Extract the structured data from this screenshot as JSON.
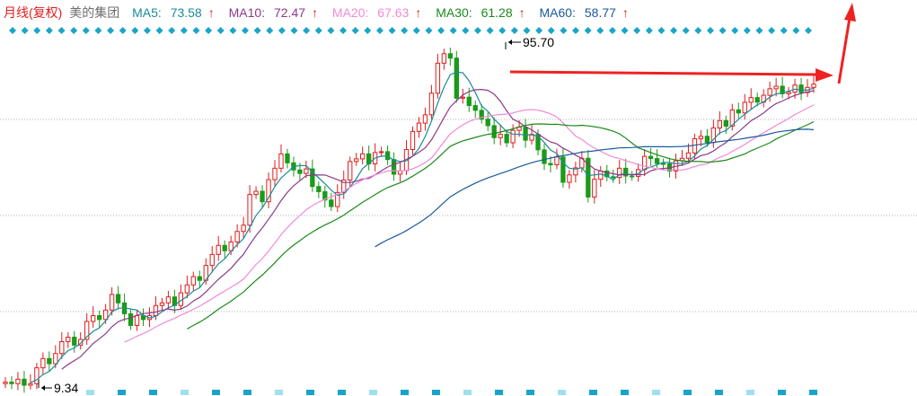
{
  "header": {
    "title": "月线(复权)",
    "stock_name": "美的集团"
  },
  "indicators": [
    {
      "label": "MA5:",
      "value": "73.58",
      "trend": "↑",
      "color": "#1a8a9a"
    },
    {
      "label": "MA10:",
      "value": "72.47",
      "trend": "↑",
      "color": "#8a3a8a"
    },
    {
      "label": "MA20:",
      "value": "67.63",
      "trend": "↑",
      "color": "#f08ad8"
    },
    {
      "label": "MA30:",
      "value": "61.28",
      "trend": "↑",
      "color": "#1a8a1a"
    },
    {
      "label": "MA60:",
      "value": "58.77",
      "trend": "↑",
      "color": "#1a5a9a"
    }
  ],
  "annotations": {
    "high_label": "95.70",
    "low_label": "9.34"
  },
  "colors": {
    "up": "#e01c1c",
    "down": "#1a9a1a",
    "marker": "#1aa5c8",
    "arrow": "#ee2222",
    "grid": "#b0b0b0"
  },
  "chart_data": {
    "type": "candlestick",
    "title": "月线(复权)",
    "y_scale": "log",
    "high": 95.7,
    "low": 9.34,
    "closes": [
      9.6,
      9.5,
      9.8,
      9.4,
      9.5,
      10.6,
      11.3,
      10.9,
      11.7,
      12.7,
      13.1,
      12.4,
      12.9,
      14.6,
      15.2,
      14.8,
      15.8,
      17.6,
      16.6,
      15.4,
      14.2,
      15.2,
      14.8,
      15.2,
      16.3,
      16.6,
      17.3,
      16.3,
      17.8,
      18.8,
      19.9,
      19.4,
      21.5,
      23.2,
      24.7,
      23.8,
      25.3,
      27.2,
      28.4,
      35.1,
      35.9,
      33.4,
      38.9,
      42.1,
      46.5,
      43.7,
      41.6,
      40.6,
      41.9,
      37.1,
      35.8,
      33.8,
      32.3,
      35.6,
      38.8,
      44.1,
      44.9,
      46.5,
      43.4,
      46.9,
      47.2,
      44.7,
      40.4,
      41.4,
      47.9,
      54.3,
      57.5,
      60.9,
      70.7,
      87.0,
      92.9,
      90.1,
      68.3,
      68.8,
      64.9,
      62.8,
      59.1,
      56.5,
      52.0,
      53.2,
      50.2,
      54.7,
      55.9,
      51.1,
      53.2,
      47.8,
      43.5,
      43.1,
      45.5,
      38.2,
      40.2,
      42.2,
      45.1,
      34.5,
      39.0,
      41.3,
      39.7,
      39.5,
      42.1,
      39.9,
      39.8,
      41.7,
      45.7,
      45.0,
      43.5,
      43.4,
      41.3,
      44.3,
      45.1,
      46.8,
      51.6,
      52.5,
      50.3,
      55.6,
      58.5,
      56.3,
      63.0,
      61.7,
      66.4,
      68.6,
      66.5,
      69.7,
      72.9,
      74.2,
      70.4,
      71.2,
      74.8,
      71.0,
      73.6,
      75.3
    ]
  },
  "markers": {
    "count_row": 66,
    "count_bottom": 24
  }
}
